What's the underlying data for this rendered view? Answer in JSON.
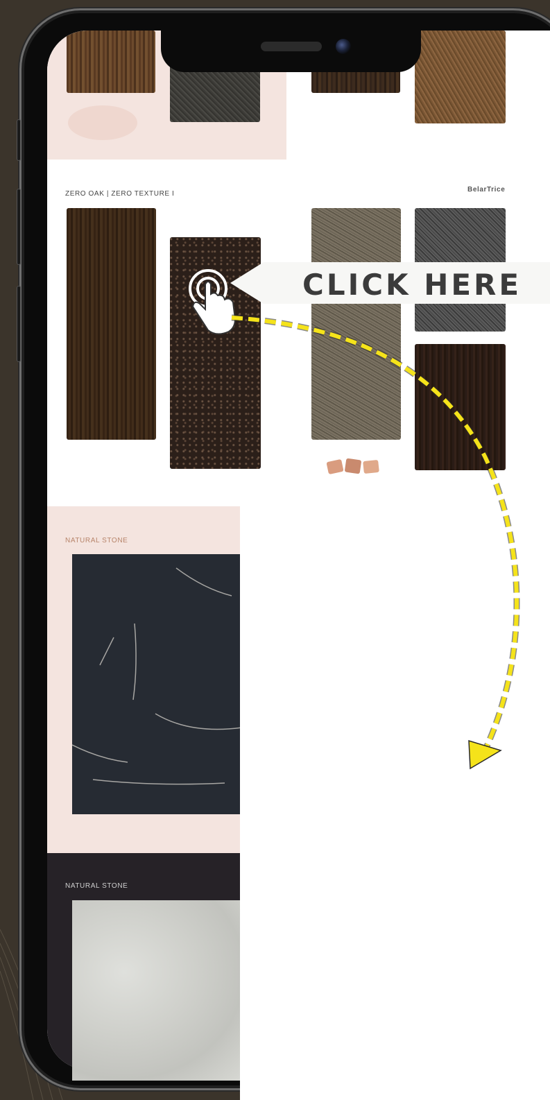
{
  "callout": {
    "label": "CLICK HERE"
  },
  "sections": {
    "zero_oak": {
      "heading": "ZERO OAK | ZERO TEXTURE I",
      "brand": "BelarTrice"
    },
    "natural_stone_pink": {
      "heading": "NATURAL STONE"
    },
    "natural_stone_dark": {
      "heading": "NATURAL STONE"
    }
  },
  "icons": [
    "tap-hand-icon",
    "dashed-arrow-icon"
  ],
  "colors": {
    "background": "#3b342b",
    "pink_panel": "#f4e4df",
    "dark_panel": "#262227",
    "arrow": "#f5e31a",
    "callout_bg": "#f7f7f5"
  }
}
